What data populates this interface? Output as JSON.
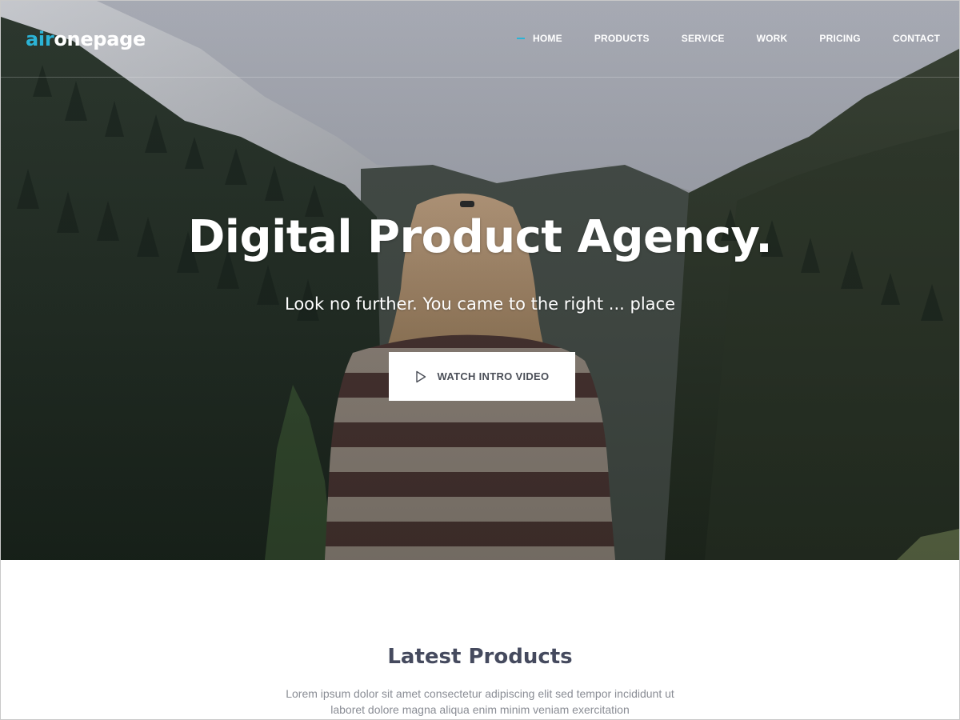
{
  "brand": {
    "logo_accent": "air",
    "logo_rest": "onepage",
    "accent_color": "#2bb3d6"
  },
  "nav": {
    "items": [
      {
        "label": "HOME",
        "active": true
      },
      {
        "label": "PRODUCTS",
        "active": false
      },
      {
        "label": "SERVICE",
        "active": false
      },
      {
        "label": "WORK",
        "active": false
      },
      {
        "label": "PRICING",
        "active": false
      },
      {
        "label": "CONTACT",
        "active": false
      }
    ]
  },
  "hero": {
    "title": "Digital Product Agency.",
    "subtitle": "Look no further. You came to the right ... place",
    "cta_label": "WATCH INTRO VIDEO",
    "cta_icon": "play-icon"
  },
  "products": {
    "title": "Latest Products",
    "description_line1": "Lorem ipsum dolor sit amet consectetur adipiscing elit sed tempor incididunt ut",
    "description_line2": "laboret dolore magna aliqua enim minim veniam exercitation"
  }
}
